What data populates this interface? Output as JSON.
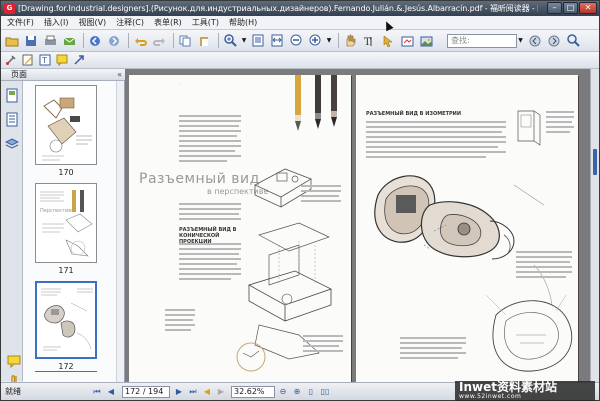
{
  "window": {
    "title": "[Drawing.for.Industrial.designers].(Рисунок.для.индустриальных.дизайнеров).Fernando.Julián.&.Jesús.Albarracín.pdf - 福昕阅读器 - [[Drawing.for.Industrial.designers].(Рисунок.для.индустриал...",
    "minimize": "–",
    "maximize": "□",
    "close": "✕"
  },
  "menu": {
    "items": [
      "文件(F)",
      "插入(I)",
      "视图(V)",
      "注释(C)",
      "表单(R)",
      "工具(T)",
      "帮助(H)"
    ]
  },
  "toolbar": {
    "search_placeholder": "查找:",
    "icons": [
      "open-icon",
      "save-icon",
      "print-icon",
      "email-icon",
      "back-icon",
      "forward-icon",
      "undo-icon",
      "hand-icon",
      "zoom-in-icon",
      "select-icon"
    ]
  },
  "sidepanel": {
    "title": "页面",
    "collapse": "«",
    "thumbnails": [
      {
        "label": "170"
      },
      {
        "label": "171"
      },
      {
        "label": "172"
      }
    ]
  },
  "document": {
    "left_page": {
      "heading": "Разъемный вид",
      "subheading": "в перспективе",
      "section": "РАЗЪЕМНЫЙ ВИД В КОНИЧЕСКОЙ ПРОЕКЦИИ"
    },
    "right_page": {
      "section": "РАЗЪЕМНЫЙ ВИД В ИЗОМЕТРИИ"
    }
  },
  "statusbar": {
    "status": "就绪",
    "page": "172 / 194",
    "zoom": "32.62%"
  },
  "watermark": {
    "text": "Inwet资料素材站",
    "sub": "www.52inwet.com"
  }
}
